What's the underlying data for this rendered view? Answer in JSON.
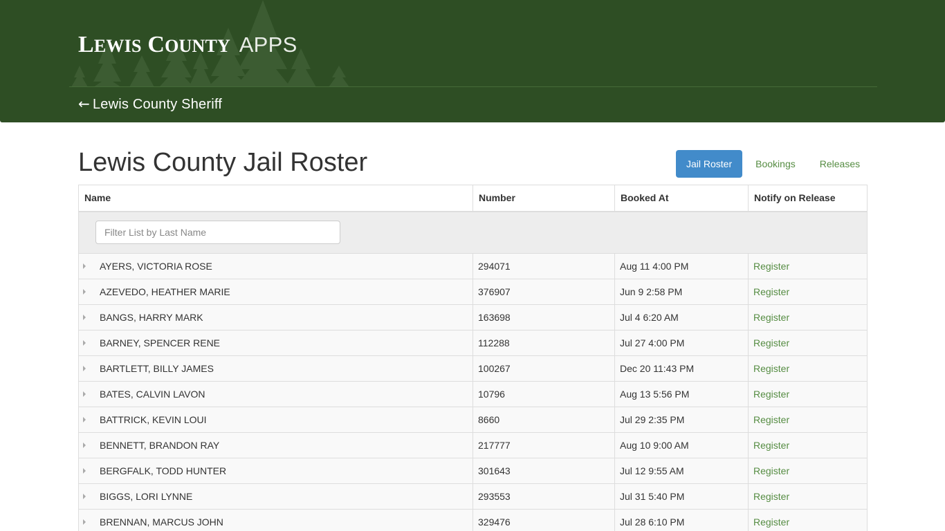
{
  "header": {
    "logo_primary_first": "L",
    "logo_primary_rest": "EWIS",
    "logo_secondary_first": "C",
    "logo_secondary_rest": "OUNTY",
    "logo_apps": "APPS",
    "back_arrow": "←",
    "back_link": "Lewis County Sheriff",
    "background_color": "#2e4e24"
  },
  "page_title": "Lewis County Jail Roster",
  "nav": {
    "jail_roster": "Jail Roster",
    "bookings": "Bookings",
    "releases": "Releases",
    "active_color": "#428bca",
    "link_color": "#558c42"
  },
  "table": {
    "headers": [
      "Name",
      "Number",
      "Booked At",
      "Notify on Release"
    ],
    "filter_placeholder": "Filter List by Last Name",
    "rows": [
      {
        "name": "AYERS, VICTORIA ROSE",
        "number": "294071",
        "booked_at": "Aug 11 4:00 PM",
        "action": "Register"
      },
      {
        "name": "AZEVEDO, HEATHER MARIE",
        "number": "376907",
        "booked_at": "Jun 9 2:58 PM",
        "action": "Register"
      },
      {
        "name": "BANGS, HARRY MARK",
        "number": "163698",
        "booked_at": "Jul 4 6:20 AM",
        "action": "Register"
      },
      {
        "name": "BARNEY, SPENCER RENE",
        "number": "112288",
        "booked_at": "Jul 27 4:00 PM",
        "action": "Register"
      },
      {
        "name": "BARTLETT, BILLY JAMES",
        "number": "100267",
        "booked_at": "Dec 20 11:43 PM",
        "action": "Register"
      },
      {
        "name": "BATES, CALVIN LAVON",
        "number": "10796",
        "booked_at": "Aug 13 5:56 PM",
        "action": "Register"
      },
      {
        "name": "BATTRICK, KEVIN LOUI",
        "number": "8660",
        "booked_at": "Jul 29 2:35 PM",
        "action": "Register"
      },
      {
        "name": "BENNETT, BRANDON RAY",
        "number": "217777",
        "booked_at": "Aug 10 9:00 AM",
        "action": "Register"
      },
      {
        "name": "BERGFALK, TODD HUNTER",
        "number": "301643",
        "booked_at": "Jul 12 9:55 AM",
        "action": "Register"
      },
      {
        "name": "BIGGS, LORI LYNNE",
        "number": "293553",
        "booked_at": "Jul 31 5:40 PM",
        "action": "Register"
      },
      {
        "name": "BRENNAN, MARCUS JOHN",
        "number": "329476",
        "booked_at": "Jul 28 6:10 PM",
        "action": "Register"
      }
    ]
  }
}
